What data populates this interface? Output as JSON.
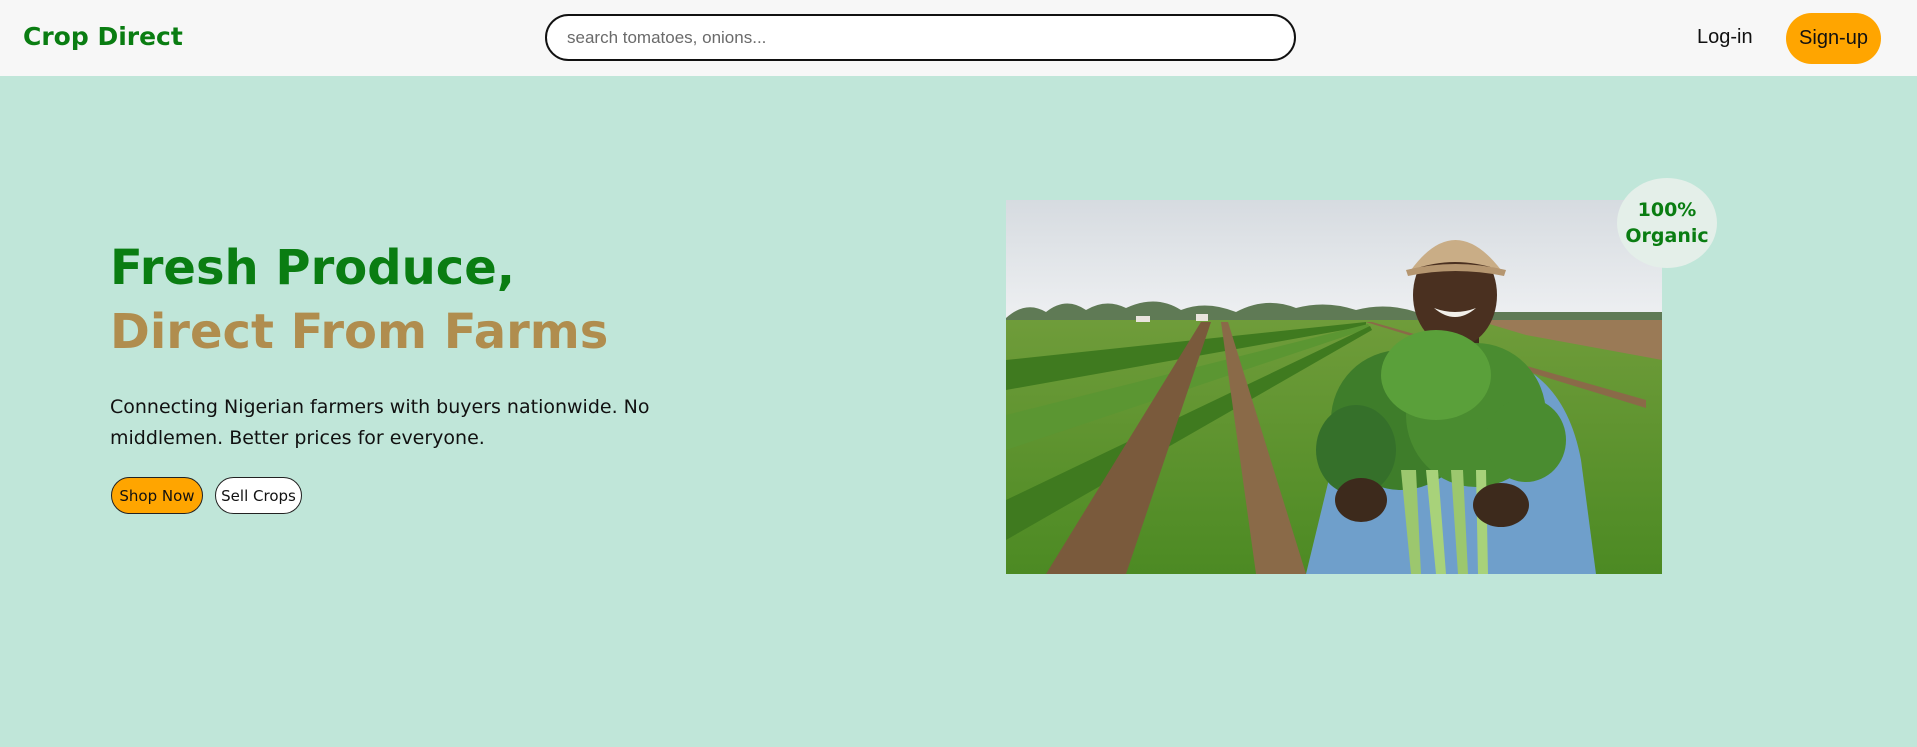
{
  "header": {
    "brand": "Crop Direct",
    "search_placeholder": "search tomatoes, onions...",
    "login_label": "Log-in",
    "signup_label": "Sign-up"
  },
  "hero": {
    "headline_line1": "Fresh Produce,",
    "headline_line2": "Direct From Farms",
    "subtitle": "Connecting Nigerian farmers with buyers nationwide. No middlemen. Better prices for everyone.",
    "shop_button": "Shop Now",
    "sell_button": "Sell Crops"
  },
  "badge": {
    "line1": "100%",
    "line2": "Organic"
  },
  "colors": {
    "brand_green": "#0a7d12",
    "accent_orange": "#ffa500",
    "tan": "#b08d4e",
    "hero_bg": "#c0e6d9"
  }
}
